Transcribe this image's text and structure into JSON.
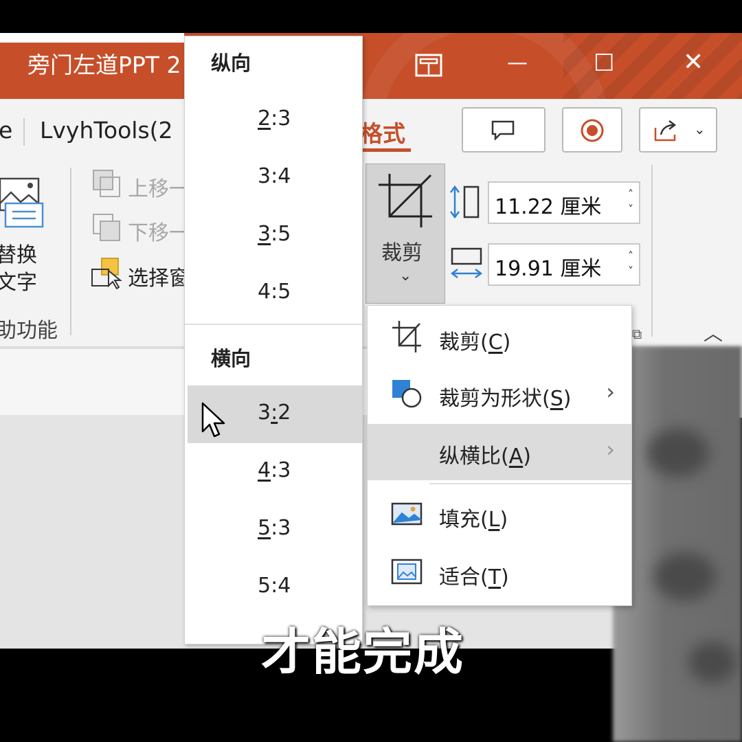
{
  "titlebar": {
    "title": "旁门左道PPT 2",
    "buttons": {
      "restore_icon": "layout-icon",
      "minimize": "—",
      "maximize": "☐",
      "close": "✕"
    },
    "color": "#c64f2a"
  },
  "ribbon": {
    "tab_partial": "e",
    "tab_lvyh": "LvyhTools(2",
    "tab_format": "格式",
    "format_accent": "#c64f2a",
    "alt_text_line1": "替换",
    "alt_text_line2": "文字",
    "group_accessibility": "助功能",
    "move_up": "上移一",
    "move_down": "下移一",
    "select_pane": "选择窗",
    "crop_button": "裁剪",
    "height_value": "11.22 厘米",
    "width_value": "19.91 厘米"
  },
  "ratio_menu": {
    "portrait_header": "纵向",
    "portrait_items": [
      {
        "pre": "",
        "key": "2",
        "post": ":3"
      },
      {
        "pre": "3:4",
        "key": "",
        "post": ""
      },
      {
        "pre": "",
        "key": "3",
        "post": ":5"
      },
      {
        "pre": "4:5",
        "key": "",
        "post": ""
      }
    ],
    "landscape_header": "横向",
    "landscape_items": [
      {
        "pre": "3",
        "key": ":",
        "post": "2"
      },
      {
        "pre": "",
        "key": "4",
        "post": ":3"
      },
      {
        "pre": "",
        "key": "5",
        "post": ":3"
      },
      {
        "pre": "5:4",
        "key": "",
        "post": ""
      }
    ]
  },
  "crop_menu": {
    "items": [
      {
        "label": "裁剪(",
        "key": "C",
        "suffix": ")"
      },
      {
        "label": "裁剪为形状(",
        "key": "S",
        "suffix": ")"
      },
      {
        "label": "纵横比(",
        "key": "A",
        "suffix": ")"
      },
      {
        "label": "填充(",
        "key": "L",
        "suffix": ")"
      },
      {
        "label": "适合(",
        "key": "T",
        "suffix": ")"
      }
    ]
  },
  "subtitle": "才能完成"
}
